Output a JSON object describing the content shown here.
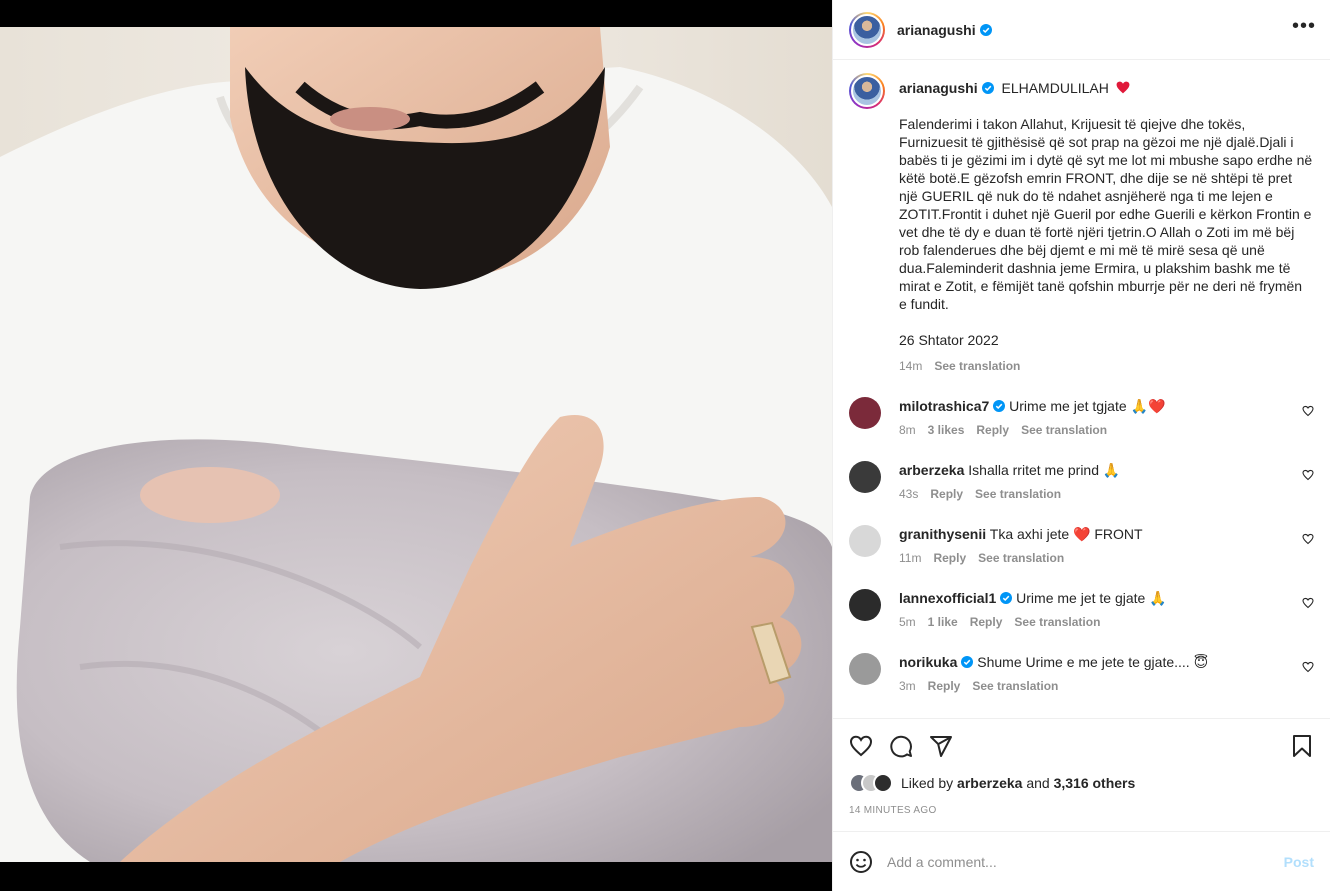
{
  "post": {
    "author": "arianagushi",
    "caption_title": "ELHAMDULILAH",
    "caption_text": "Falenderimi i takon Allahut, Krijuesit të qiejve dhe tokës, Furnizuesit të gjithësisë që sot prap na gëzoi me një djalë.Djali i babës ti je gëzimi im i dytë që syt me lot mi mbushe sapo erdhe në këtë botë.E gëzofsh emrin FRONT, dhe dije se në shtëpi të pret një GUERIL që nuk do të ndahet asnjëherë nga ti me lejen e ZOTIT.Frontit i duhet një Gueril por edhe Guerili e kërkon Frontin e vet dhe të dy e duan të fortë njëri tjetrin.O Allah o Zoti im më bëj rob falenderues dhe bëj djemt e mi më të mirë sesa që unë dua.Faleminderit dashnia jeme Ermira, u plakshim bashk me të mirat e Zotit, e fëmijët tanë qofshin mburrje për ne deri në frymën e fundit.",
    "caption_date": "26 Shtator 2022",
    "caption_age": "14m",
    "see_translation": "See translation"
  },
  "comments": [
    {
      "user": "milotrashica7",
      "verified": true,
      "text": "Urime me jet tgjate 🙏❤️",
      "age": "8m",
      "likes": "3 likes",
      "reply": "Reply",
      "translate": "See translation",
      "avatar_color": "#7b2a3a"
    },
    {
      "user": "arberzeka",
      "verified": false,
      "text": "Ishalla rritet me prind 🙏",
      "age": "43s",
      "likes": "",
      "reply": "Reply",
      "translate": "See translation",
      "avatar_color": "#3a3a3a"
    },
    {
      "user": "granithysenii",
      "verified": false,
      "text": "Tka axhi jete ❤️ FRONT",
      "age": "11m",
      "likes": "",
      "reply": "Reply",
      "translate": "See translation",
      "avatar_color": "#d8d8d8"
    },
    {
      "user": "lannexofficial1",
      "verified": true,
      "text": "Urime me jet te gjate 🙏",
      "age": "5m",
      "likes": "1 like",
      "reply": "Reply",
      "translate": "See translation",
      "avatar_color": "#2b2b2b"
    },
    {
      "user": "norikuka",
      "verified": true,
      "text": "Shume Urime e me jete te gjate.... 😇",
      "age": "3m",
      "likes": "",
      "reply": "Reply",
      "translate": "See translation",
      "avatar_color": "#9a9a9a"
    }
  ],
  "likes": {
    "prefix": "Liked by",
    "user": "arberzeka",
    "and": "and",
    "others": "3,316 others"
  },
  "timestamp": "14 MINUTES AGO",
  "comment_box": {
    "placeholder": "Add a comment...",
    "post_label": "Post"
  },
  "colors": {
    "verified": "#0095f6",
    "heart": "#ed4956",
    "post_button": "#b2dffc"
  }
}
